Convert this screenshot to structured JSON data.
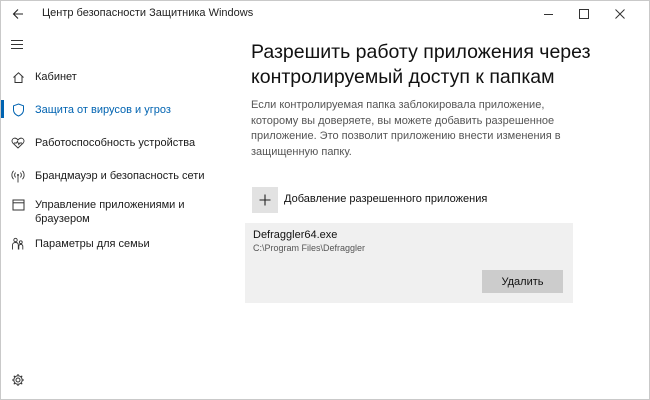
{
  "window": {
    "title": "Центр безопасности Защитника Windows"
  },
  "sidebar": {
    "items": [
      {
        "label": "Кабинет",
        "icon": "home-icon"
      },
      {
        "label": "Защита от вирусов и угроз",
        "icon": "shield-icon",
        "active": true
      },
      {
        "label": "Работоспособность устройства",
        "icon": "heart-icon"
      },
      {
        "label": "Брандмауэр и безопасность сети",
        "icon": "antenna-icon"
      },
      {
        "label": "Управление приложениями и браузером",
        "icon": "browser-window-icon"
      },
      {
        "label": "Параметры для семьи",
        "icon": "family-icon"
      }
    ]
  },
  "main": {
    "title": "Разрешить работу приложения через контролируемый доступ к папкам",
    "description": "Если контролируемая папка заблокировала приложение, которому вы доверяете, вы можете добавить разрешенное приложение. Это позволит приложению внести изменения в защищенную папку.",
    "add_label": "Добавление разрешенного приложения",
    "app": {
      "name": "Defraggler64.exe",
      "path": "C:\\Program Files\\Defraggler",
      "remove_label": "Удалить"
    }
  },
  "colors": {
    "accent": "#0063b1",
    "card_bg": "#f0f0f0",
    "button_bg": "#cccccc"
  }
}
